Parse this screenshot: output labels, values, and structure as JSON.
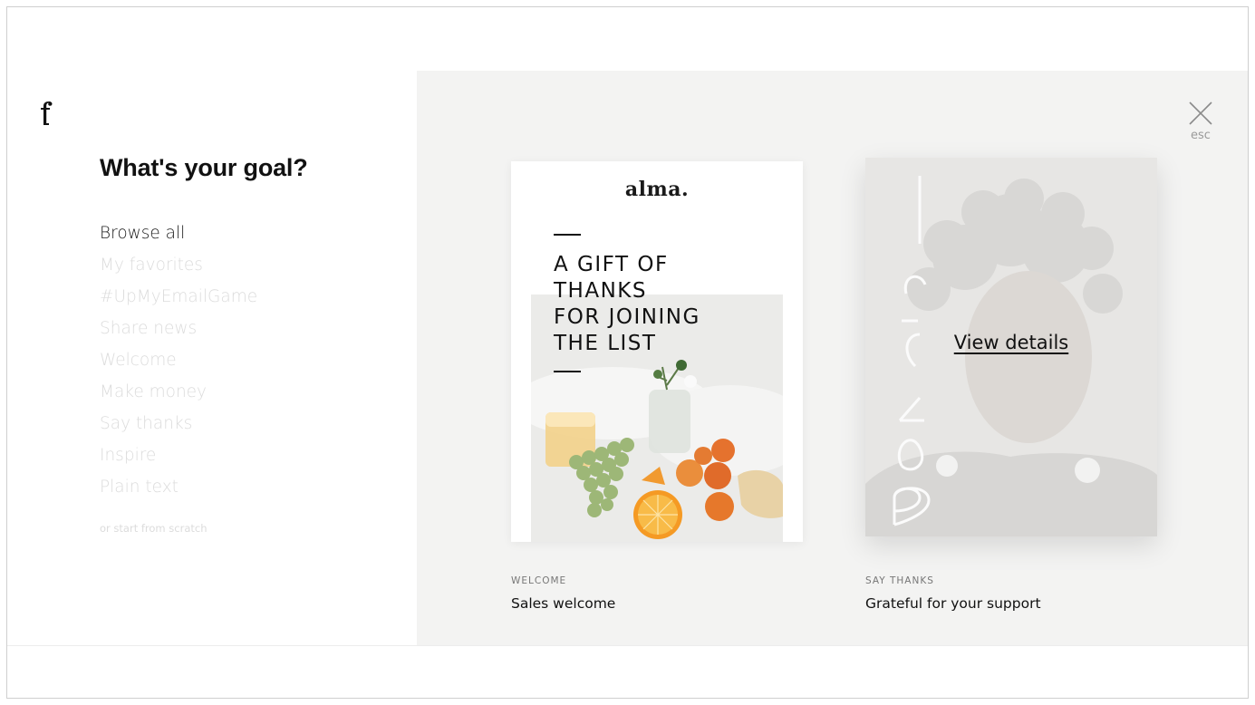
{
  "sidebar": {
    "logo": "f",
    "title": "What's your goal?",
    "goals": [
      {
        "label": "Browse all",
        "active": true
      },
      {
        "label": "My favorites",
        "active": false
      },
      {
        "label": "#UpMyEmailGame",
        "active": false
      },
      {
        "label": "Share news",
        "active": false
      },
      {
        "label": "Welcome",
        "active": false
      },
      {
        "label": "Make money",
        "active": false
      },
      {
        "label": "Say thanks",
        "active": false
      },
      {
        "label": "Inspire",
        "active": false
      },
      {
        "label": "Plain text",
        "active": false
      }
    ],
    "scratch_link": "or start from scratch"
  },
  "gallery": {
    "close_label": "esc",
    "templates": [
      {
        "brand": "alma.",
        "headline": "A GIFT OF\nTHANKS\nFOR JOINING\nTHE LIST",
        "category": "WELCOME",
        "name": "Sales welcome"
      },
      {
        "overlay_text": "View details",
        "category": "SAY THANKS",
        "name": "Grateful for your support"
      }
    ]
  },
  "colors": {
    "gallery_bg": "#f3f3f2",
    "inactive_text": "#dcdcdc",
    "active_text": "#1a1a1a"
  }
}
